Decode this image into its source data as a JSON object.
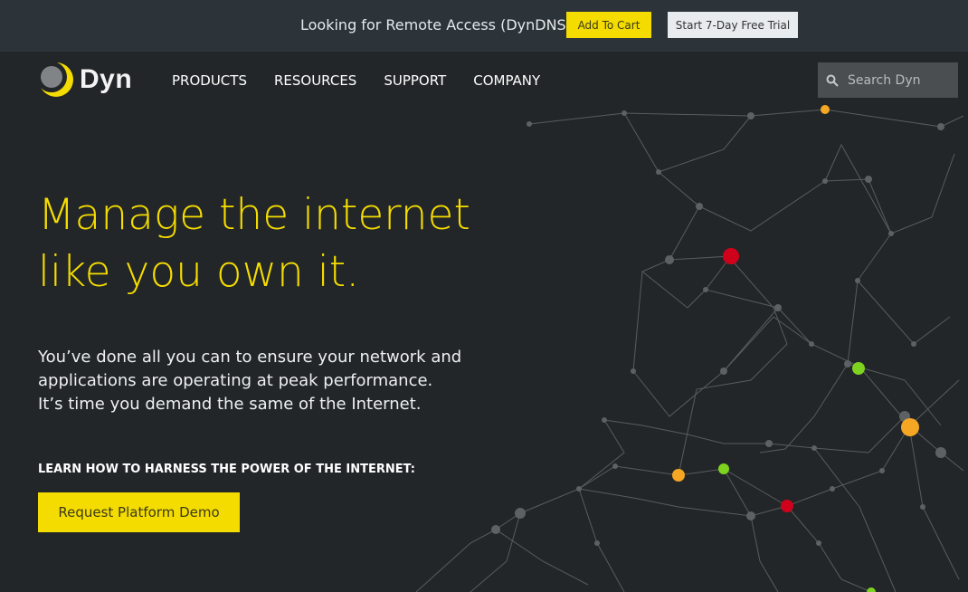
{
  "topbar": {
    "promo_text": "Looking for Remote Access (DynDNS)?",
    "add_to_cart_label": "Add To Cart",
    "trial_label": "Start 7-Day Free Trial"
  },
  "header": {
    "logo_text": "Dyn",
    "nav": [
      "PRODUCTS",
      "RESOURCES",
      "SUPPORT",
      "COMPANY"
    ],
    "search_placeholder": "Search Dyn"
  },
  "hero": {
    "headline_line1": "Manage the internet",
    "headline_line2": "like you own it.",
    "body_line1": "You’ve done all you can to ensure your network and",
    "body_line2": "applications are operating at peak performance.",
    "body_line3": "It’s time you demand the same of the Internet.",
    "cta_label": "LEARN HOW TO HARNESS THE POWER OF THE INTERNET:",
    "demo_button_label": "Request Platform Demo"
  },
  "colors": {
    "background": "#222628",
    "topbar": "#2c343a",
    "accent_yellow": "#f5dc00",
    "node_red": "#d0021b",
    "node_green": "#7ed321",
    "node_orange": "#f5a623"
  }
}
